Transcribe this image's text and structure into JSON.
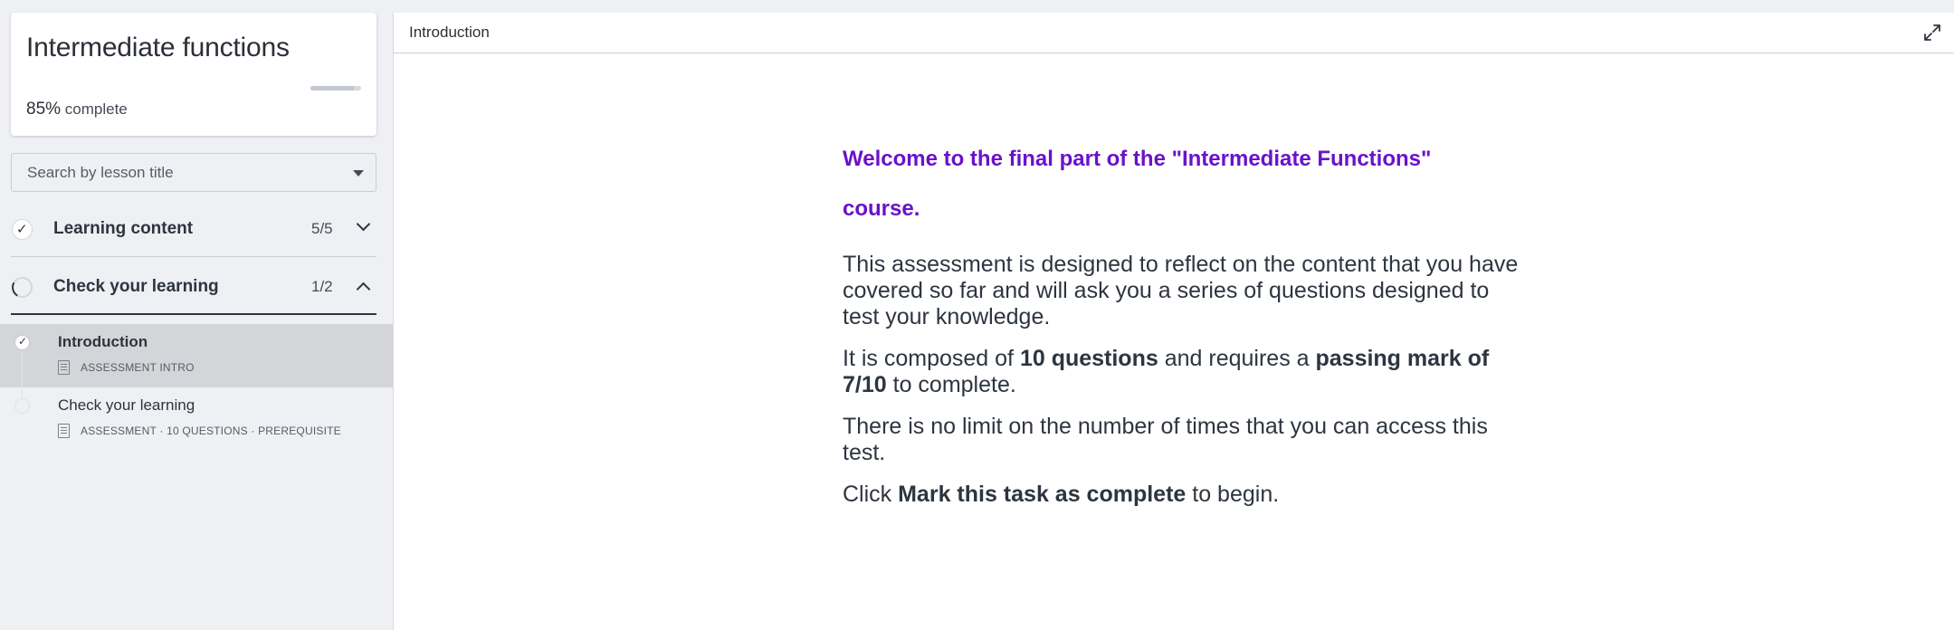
{
  "sidebar": {
    "course_title": "Intermediate functions",
    "progress": {
      "percent": "85%",
      "suffix": "complete",
      "value": 0.85
    },
    "search": {
      "placeholder": "Search by lesson title"
    },
    "sections": [
      {
        "title": "Learning content",
        "count": "5/5",
        "status": "complete",
        "expanded": false
      },
      {
        "title": "Check your learning",
        "count": "1/2",
        "status": "in-progress",
        "expanded": true
      }
    ],
    "lessons": [
      {
        "title": "Introduction",
        "meta": "ASSESSMENT INTRO",
        "icon": "document-icon",
        "done": true,
        "selected": true
      },
      {
        "title": "Check your learning",
        "meta": "ASSESSMENT · 10 QUESTIONS · PREREQUISITE",
        "icon": "quiz-icon",
        "done": false,
        "selected": false
      }
    ]
  },
  "main": {
    "header_title": "Introduction",
    "expand_icon": "expand-icon",
    "welcome": "Welcome to the final part of the \"Intermediate Functions\" course.",
    "p1": "This assessment is designed to reflect on the content that you have covered so far and will ask you a series of questions designed to test your knowledge.",
    "p2": {
      "a": "It is composed of ",
      "b": "10 questions",
      "c": " and requires a ",
      "d": "passing mark of 7/10",
      "e": " to complete."
    },
    "p3": "There is no limit on the number of times that you can access this test.",
    "p4": {
      "a": "Click ",
      "b": "Mark this task as complete",
      "c": " to begin."
    }
  },
  "colors": {
    "accent_purple": "#6a12c9",
    "text_dark": "#2d3540",
    "sidebar_bg": "#eef0f3",
    "selected_lesson_bg": "#d3d5d9"
  }
}
